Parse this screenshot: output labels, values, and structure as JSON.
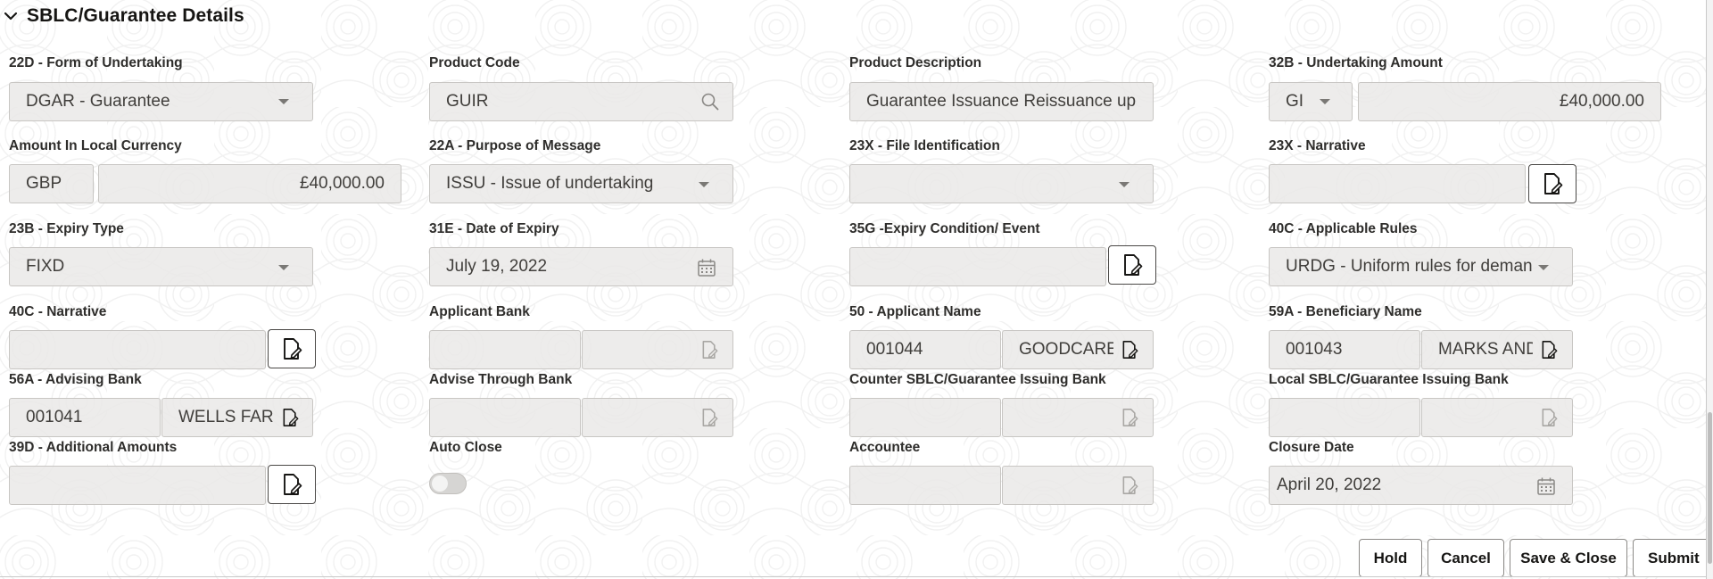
{
  "section": {
    "title": "SBLC/Guarantee Details",
    "chevron_icon": "chevron-down-icon"
  },
  "fields": {
    "form_of_undertaking": {
      "label": "22D - Form of Undertaking",
      "value": "DGAR - Guarantee"
    },
    "product_code": {
      "label": "Product Code",
      "value": "GUIR"
    },
    "product_description": {
      "label": "Product Description",
      "value": "Guarantee Issuance  Reissuance upon"
    },
    "undertaking_amount": {
      "label": "32B - Undertaking Amount",
      "currency": "GI",
      "amount": "£40,000.00"
    },
    "amount_local_currency": {
      "label": "Amount In Local Currency",
      "currency": "GBP",
      "amount": "£40,000.00"
    },
    "purpose_of_message": {
      "label": "22A - Purpose of Message",
      "value": "ISSU - Issue of undertaking"
    },
    "file_identification": {
      "label": "23X - File Identification",
      "value": ""
    },
    "narrative_23x": {
      "label": "23X - Narrative",
      "value": ""
    },
    "expiry_type": {
      "label": "23B - Expiry Type",
      "value": "FIXD"
    },
    "date_of_expiry": {
      "label": "31E - Date of Expiry",
      "value": "July 19, 2022"
    },
    "expiry_condition": {
      "label": "35G -Expiry Condition/ Event",
      "value": ""
    },
    "applicable_rules": {
      "label": "40C - Applicable Rules",
      "value": "URDG - Uniform rules for demand guarantees"
    },
    "narrative_40c": {
      "label": "40C - Narrative",
      "value": ""
    },
    "applicant_bank": {
      "label": "Applicant Bank",
      "id": "",
      "name": ""
    },
    "applicant_name": {
      "label": "50 - Applicant Name",
      "id": "001044",
      "name": "GOODCARE"
    },
    "beneficiary_name": {
      "label": "59A - Beneficiary Name",
      "id": "001043",
      "name": "MARKS AND"
    },
    "advising_bank": {
      "label": "56A - Advising Bank",
      "id": "001041",
      "name": "WELLS FARGO"
    },
    "advise_through_bank": {
      "label": "Advise Through Bank",
      "id": "",
      "name": ""
    },
    "counter_issuing_bank": {
      "label": "Counter SBLC/Guarantee Issuing Bank",
      "id": "",
      "name": ""
    },
    "local_issuing_bank": {
      "label": "Local SBLC/Guarantee Issuing Bank",
      "id": "",
      "name": ""
    },
    "additional_amounts": {
      "label": "39D - Additional Amounts",
      "value": ""
    },
    "auto_close": {
      "label": "Auto Close",
      "enabled": false
    },
    "accountee": {
      "label": "Accountee",
      "id": "",
      "name": ""
    },
    "closure_date": {
      "label": "Closure Date",
      "value": "April 20, 2022"
    }
  },
  "actions": {
    "hold": "Hold",
    "cancel": "Cancel",
    "save_close": "Save & Close",
    "submit": "Submit"
  },
  "icons": {
    "search": "search-icon",
    "calendar": "calendar-icon",
    "edit": "edit-document-icon",
    "dropdown": "chevron-down-icon"
  },
  "colors": {
    "field_bg": "#e9e8e6",
    "border": "#c8c6c3",
    "text": "#161513"
  }
}
